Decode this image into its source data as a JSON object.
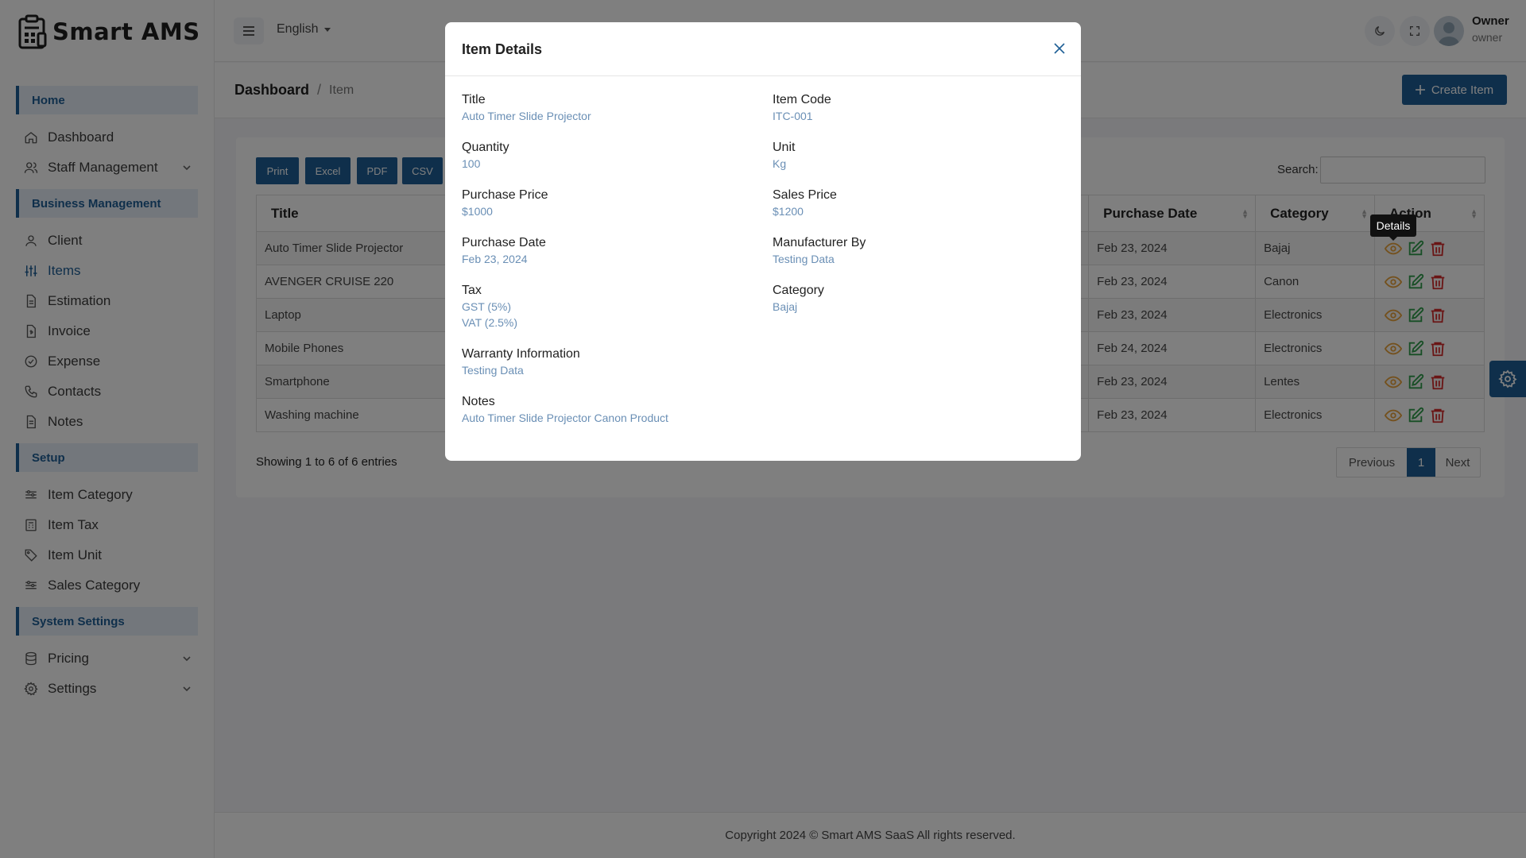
{
  "brand": {
    "name": "Smart AMS"
  },
  "sidebar": {
    "sections": [
      {
        "title": "Home",
        "items": [
          {
            "label": "Dashboard",
            "icon": "home-icon"
          },
          {
            "label": "Staff Management",
            "icon": "users-icon",
            "expandable": true
          }
        ]
      },
      {
        "title": "Business Management",
        "items": [
          {
            "label": "Client",
            "icon": "user-icon"
          },
          {
            "label": "Items",
            "icon": "sliders-icon",
            "active": true
          },
          {
            "label": "Estimation",
            "icon": "file-icon"
          },
          {
            "label": "Invoice",
            "icon": "invoice-icon"
          },
          {
            "label": "Expense",
            "icon": "check-circle-icon"
          },
          {
            "label": "Contacts",
            "icon": "phone-icon"
          },
          {
            "label": "Notes",
            "icon": "note-icon"
          }
        ]
      },
      {
        "title": "Setup",
        "items": [
          {
            "label": "Item Category",
            "icon": "category-icon"
          },
          {
            "label": "Item Tax",
            "icon": "tax-icon"
          },
          {
            "label": "Item Unit",
            "icon": "tag-icon"
          },
          {
            "label": "Sales Category",
            "icon": "category-icon"
          }
        ]
      },
      {
        "title": "System Settings",
        "items": [
          {
            "label": "Pricing",
            "icon": "database-icon",
            "expandable": true
          },
          {
            "label": "Settings",
            "icon": "gear-icon",
            "expandable": true
          }
        ]
      }
    ]
  },
  "header": {
    "language": "English",
    "user_name": "Owner",
    "user_role": "owner"
  },
  "breadcrumb": {
    "root": "Dashboard",
    "separator": "/",
    "current": "Item"
  },
  "toolbar": {
    "create_label": "Create Item"
  },
  "exports": [
    "Print",
    "Excel",
    "PDF",
    "CSV"
  ],
  "search": {
    "label": "Search:"
  },
  "table": {
    "columns": [
      "Title",
      "Purchase Date",
      "Category",
      "Action"
    ],
    "rows": [
      {
        "title": "Auto Timer Slide Projector",
        "purchase_date": "Feb 23, 2024",
        "category": "Bajaj"
      },
      {
        "title": "AVENGER CRUISE 220",
        "purchase_date": "Feb 23, 2024",
        "category": "Canon"
      },
      {
        "title": "Laptop",
        "purchase_date": "Feb 23, 2024",
        "category": "Electronics"
      },
      {
        "title": "Mobile Phones",
        "purchase_date": "Feb 24, 2024",
        "category": "Electronics"
      },
      {
        "title": "Smartphone",
        "purchase_date": "Feb 23, 2024",
        "category": "Lentes"
      },
      {
        "title": "Washing machine",
        "purchase_date": "Feb 23, 2024",
        "category": "Electronics"
      }
    ],
    "showing": "Showing 1 to 6 of 6 entries"
  },
  "pagination": {
    "previous": "Previous",
    "current": "1",
    "next": "Next"
  },
  "tooltip": "Details",
  "footer": "Copyright 2024 © Smart AMS SaaS All rights reserved.",
  "modal": {
    "title": "Item Details",
    "left": [
      {
        "label": "Title",
        "values": [
          "Auto Timer Slide Projector"
        ]
      },
      {
        "label": "Quantity",
        "values": [
          "100"
        ]
      },
      {
        "label": "Purchase Price",
        "values": [
          "$1000"
        ]
      },
      {
        "label": "Purchase Date",
        "values": [
          "Feb 23, 2024"
        ]
      },
      {
        "label": "Tax",
        "values": [
          "GST (5%)",
          "VAT (2.5%)"
        ]
      },
      {
        "label": "Warranty Information",
        "values": [
          "Testing Data"
        ]
      },
      {
        "label": "Notes",
        "values": [
          "Auto Timer Slide Projector Canon Product"
        ]
      }
    ],
    "right": [
      {
        "label": "Item Code",
        "values": [
          "ITC-001"
        ]
      },
      {
        "label": "Unit",
        "values": [
          "Kg"
        ]
      },
      {
        "label": "Sales Price",
        "values": [
          "$1200"
        ]
      },
      {
        "label": "Manufacturer By",
        "values": [
          "Testing Data"
        ]
      },
      {
        "label": "Category",
        "values": [
          "Bajaj"
        ]
      }
    ]
  },
  "colors": {
    "primary": "#1f5f96",
    "eye": "#e8a33c",
    "edit": "#2e9d4a",
    "delete": "#d42a2a",
    "value_text": "#6a8fb5"
  }
}
